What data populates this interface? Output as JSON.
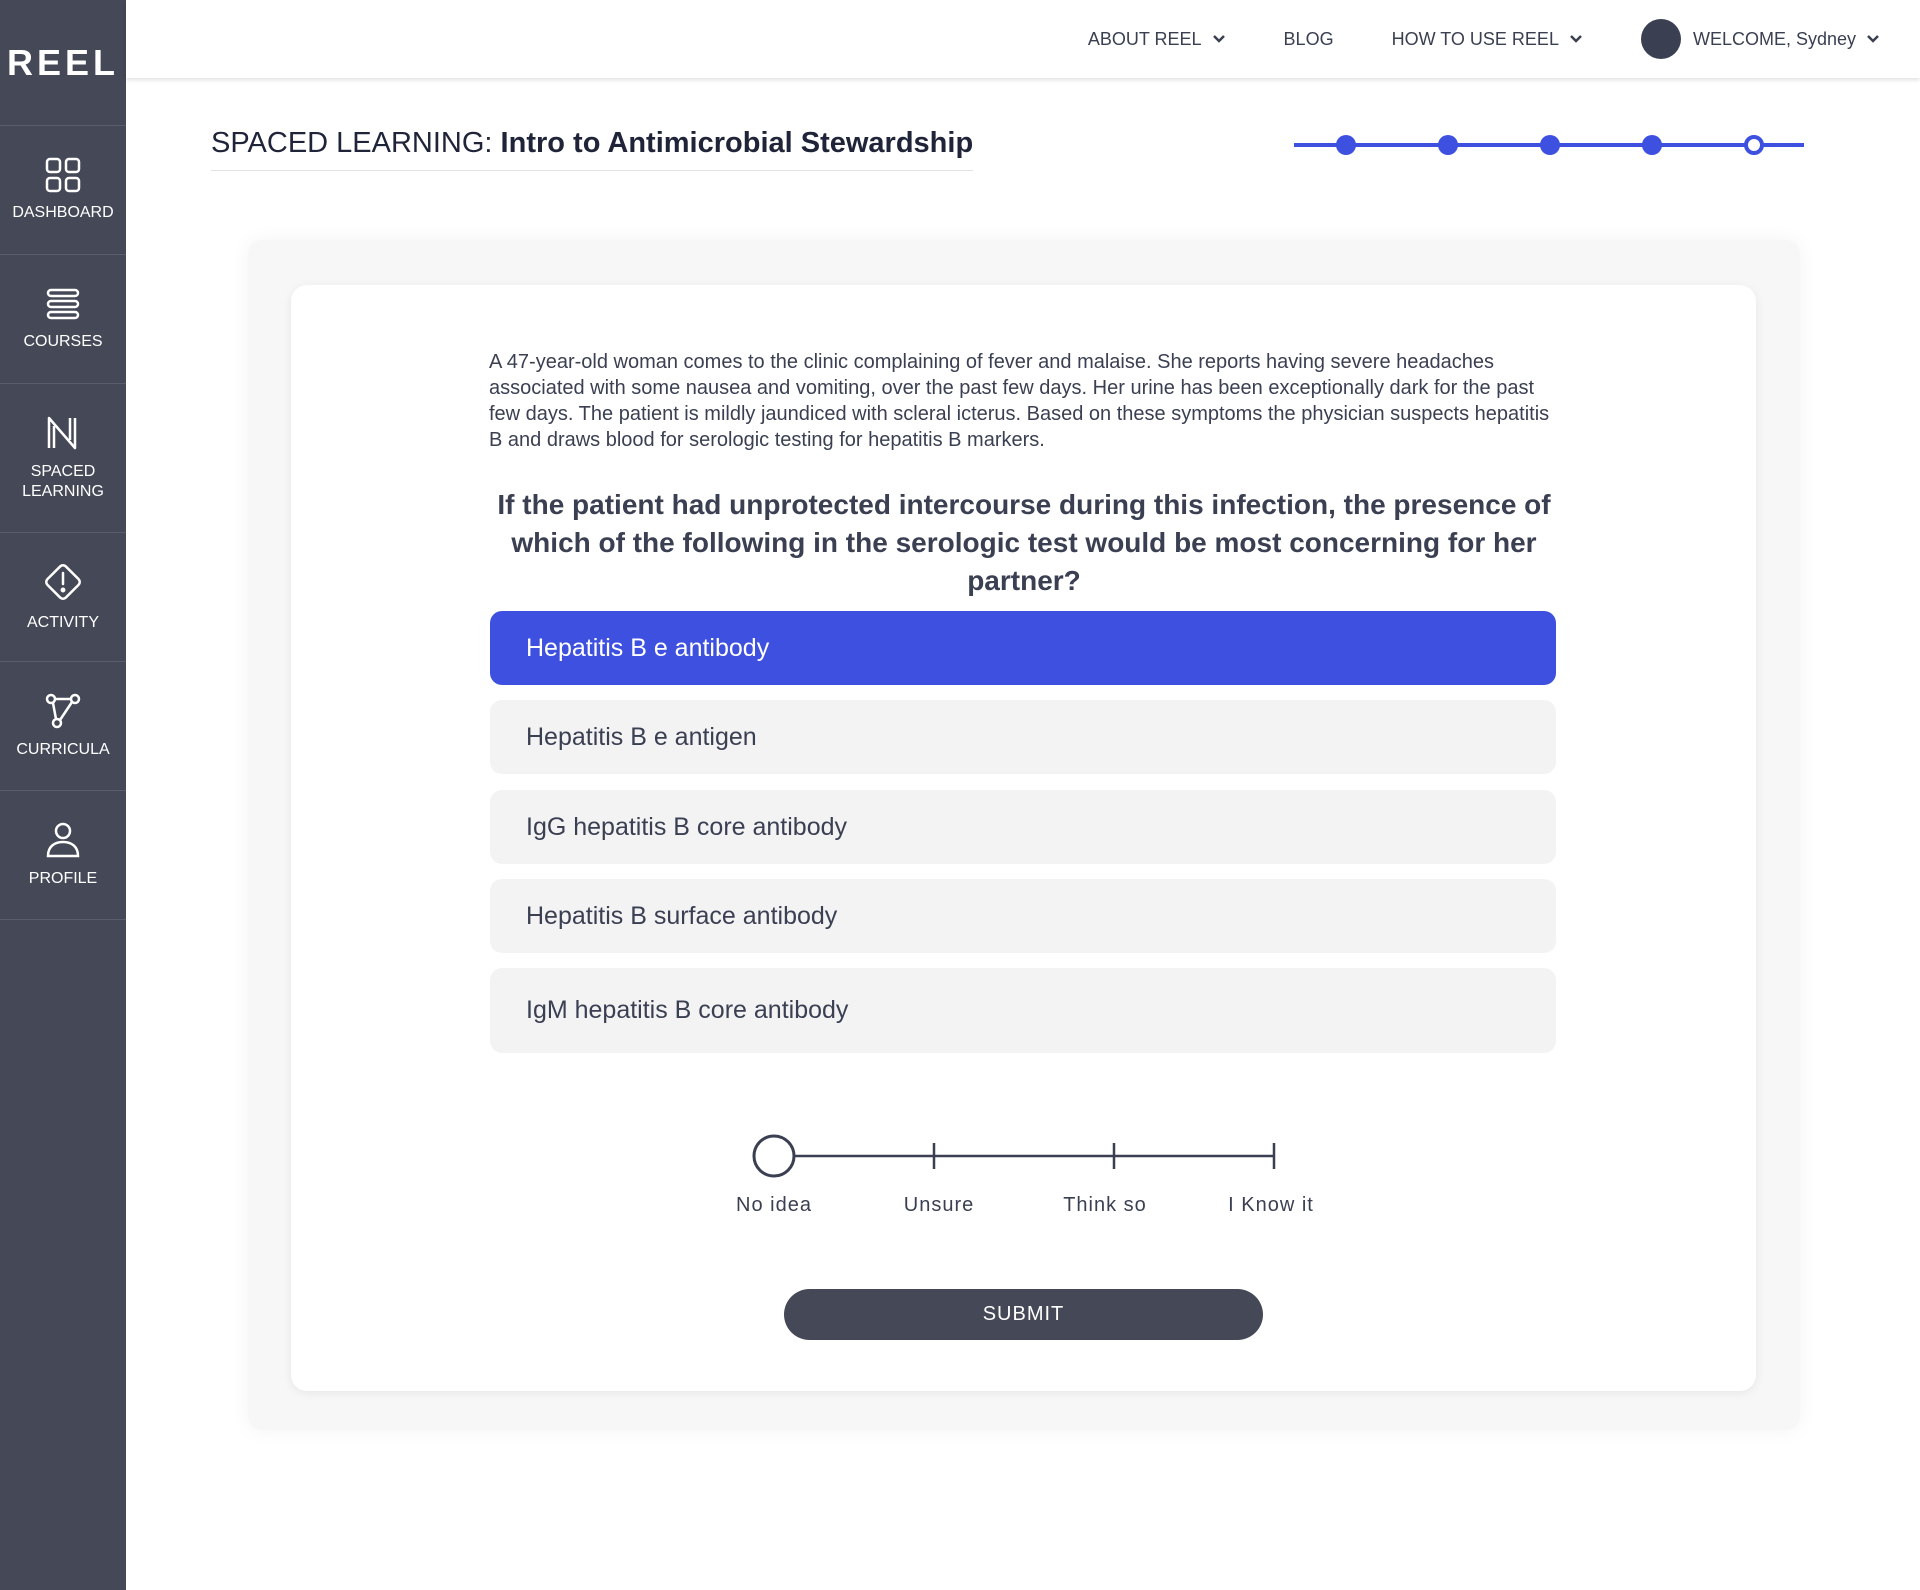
{
  "app": {
    "logo": "REEL"
  },
  "sidebar": {
    "items": [
      {
        "label": "DASHBOARD",
        "icon": "grid-icon"
      },
      {
        "label": "COURSES",
        "icon": "stack-icon"
      },
      {
        "label": "SPACED LEARNING",
        "icon": "spaced-learning-icon"
      },
      {
        "label": "ACTIVITY",
        "icon": "alert-diamond-icon"
      },
      {
        "label": "CURRICULA",
        "icon": "network-icon"
      },
      {
        "label": "PROFILE",
        "icon": "user-icon"
      }
    ]
  },
  "topnav": {
    "about": "ABOUT REEL",
    "blog": "BLOG",
    "howto": "HOW TO USE REEL",
    "welcome": "WELCOME, Sydney"
  },
  "page": {
    "title_prefix": "SPACED LEARNING:",
    "title_name": "Intro to Antimicrobial Stewardship",
    "progress": {
      "total_steps": 5,
      "completed_steps": 4,
      "current_step": 5
    },
    "accent_color": "#3d50e0"
  },
  "question": {
    "vignette": "A 47-year-old woman comes to the clinic complaining of fever and malaise. She reports having severe headaches associated with some nausea and vomiting, over the past few days. Her urine has been exceptionally dark for the past few days. The patient is mildly jaundiced with scleral icterus. Based on these symptoms the physician suspects hepatitis B and draws blood for serologic testing for hepatitis B markers.",
    "stem": "If the patient had unprotected intercourse during this infection, the presence of which of the following in the serologic test would be most concerning for her partner?",
    "options": [
      {
        "label": "Hepatitis B e antibody",
        "selected": true
      },
      {
        "label": "Hepatitis B e antigen",
        "selected": false
      },
      {
        "label": "IgG hepatitis B core antibody",
        "selected": false
      },
      {
        "label": "Hepatitis B surface antibody",
        "selected": false
      },
      {
        "label": "IgM hepatitis B core antibody",
        "selected": false
      }
    ]
  },
  "confidence": {
    "levels": [
      "No idea",
      "Unsure",
      "Think so",
      "I Know it"
    ],
    "selected_index": 0
  },
  "submit_label": "SUBMIT"
}
